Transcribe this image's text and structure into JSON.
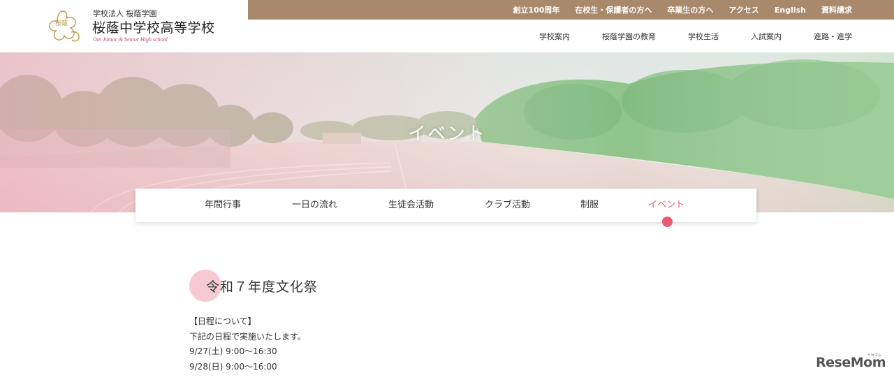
{
  "header": {
    "emblem_text": "桜蔭",
    "school_corp": "学校法人 桜蔭学園",
    "school_name": "桜蔭中学校高等学校",
    "school_en": "Oin Junior & Senior High school",
    "topbar_links": [
      "創立100周年",
      "在校生・保護者の方へ",
      "卒業生の方へ",
      "アクセス",
      "English",
      "資料請求"
    ],
    "main_nav": [
      "学校案内",
      "桜蔭学園の教育",
      "学校生活",
      "入試案内",
      "進路・進学"
    ]
  },
  "hero": {
    "title": "イベント"
  },
  "subtabs": [
    "年間行事",
    "一日の流れ",
    "生徒会活動",
    "クラブ活動",
    "制服",
    "イベント"
  ],
  "active_tab": "イベント",
  "event": {
    "title": "令和７年度文化祭",
    "lines": [
      "【日程について】",
      "下記の日程で実施いたします。",
      "9/27(土) 9:00〜16:30",
      "9/28(日) 9:00〜16:00"
    ]
  },
  "watermark": {
    "text": "ReseMom",
    "small": "リセマム"
  },
  "colors": {
    "topbar": "#a8896c",
    "accent_pink": "#e0607a",
    "dot": "#e8586e",
    "circle": "#f7c9d0"
  }
}
